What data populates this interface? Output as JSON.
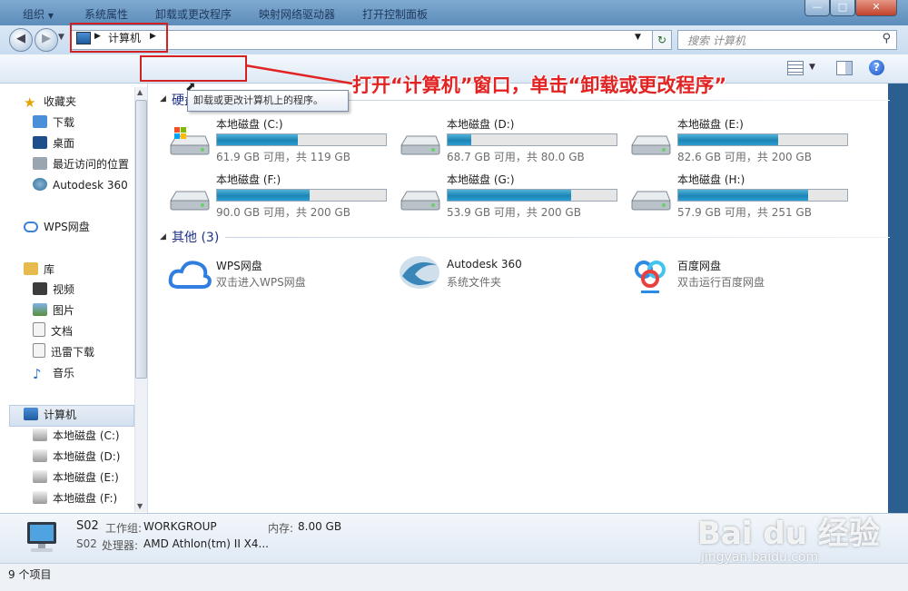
{
  "address": {
    "crumb": "计算机",
    "search_placeholder": "搜索 计算机"
  },
  "toolbar": {
    "organize": "组织",
    "system_properties": "系统属性",
    "uninstall": "卸载或更改程序",
    "map_drive": "映射网络驱动器",
    "control_panel": "打开控制面板"
  },
  "tooltip": "卸载或更改计算机上的程序。",
  "annotation": "打开“计算机”窗口，单击“卸载或更改程序”",
  "sidebar": {
    "favorites": {
      "title": "收藏夹",
      "items": [
        "下载",
        "桌面",
        "最近访问的位置",
        "Autodesk 360"
      ]
    },
    "wps": "WPS网盘",
    "libraries": {
      "title": "库",
      "items": [
        "视频",
        "图片",
        "文档",
        "迅雷下载",
        "音乐"
      ]
    },
    "computer": {
      "title": "计算机",
      "items": [
        "本地磁盘 (C:)",
        "本地磁盘 (D:)",
        "本地磁盘 (E:)",
        "本地磁盘 (F:)"
      ]
    }
  },
  "content": {
    "hdd_group": "硬盘",
    "other_group": "其他 (3)",
    "drives": [
      {
        "name": "本地磁盘 (C:)",
        "info": "61.9 GB 可用，共 119 GB",
        "used_fraction": 0.48
      },
      {
        "name": "本地磁盘 (D:)",
        "info": "68.7 GB 可用，共 80.0 GB",
        "used_fraction": 0.14
      },
      {
        "name": "本地磁盘 (E:)",
        "info": "82.6 GB 可用，共 200 GB",
        "used_fraction": 0.59
      },
      {
        "name": "本地磁盘 (F:)",
        "info": "90.0 GB 可用，共 200 GB",
        "used_fraction": 0.55
      },
      {
        "name": "本地磁盘 (G:)",
        "info": "53.9 GB 可用，共 200 GB",
        "used_fraction": 0.73
      },
      {
        "name": "本地磁盘 (H:)",
        "info": "57.9 GB 可用，共 251 GB",
        "used_fraction": 0.77
      }
    ],
    "others": [
      {
        "name": "WPS网盘",
        "sub": "双击进入WPS网盘"
      },
      {
        "name": "Autodesk 360",
        "sub": "系统文件夹"
      },
      {
        "name": "百度网盘",
        "sub": "双击运行百度网盘"
      }
    ]
  },
  "details": {
    "pc_name": "S02",
    "workgroup_label": "工作组:",
    "workgroup": "WORKGROUP",
    "memory_label": "内存:",
    "memory": "8.00 GB",
    "pc_name2": "S02",
    "cpu_label": "处理器:",
    "cpu": "AMD Athlon(tm) II X4..."
  },
  "status": {
    "count": "9 个项目"
  },
  "watermark": {
    "brand": "Bai du 经验",
    "url": "jingyan.baidu.com"
  },
  "colors": {
    "accent": "#1d84b5",
    "annotation": "#e22323",
    "group_title": "#1e3287"
  }
}
